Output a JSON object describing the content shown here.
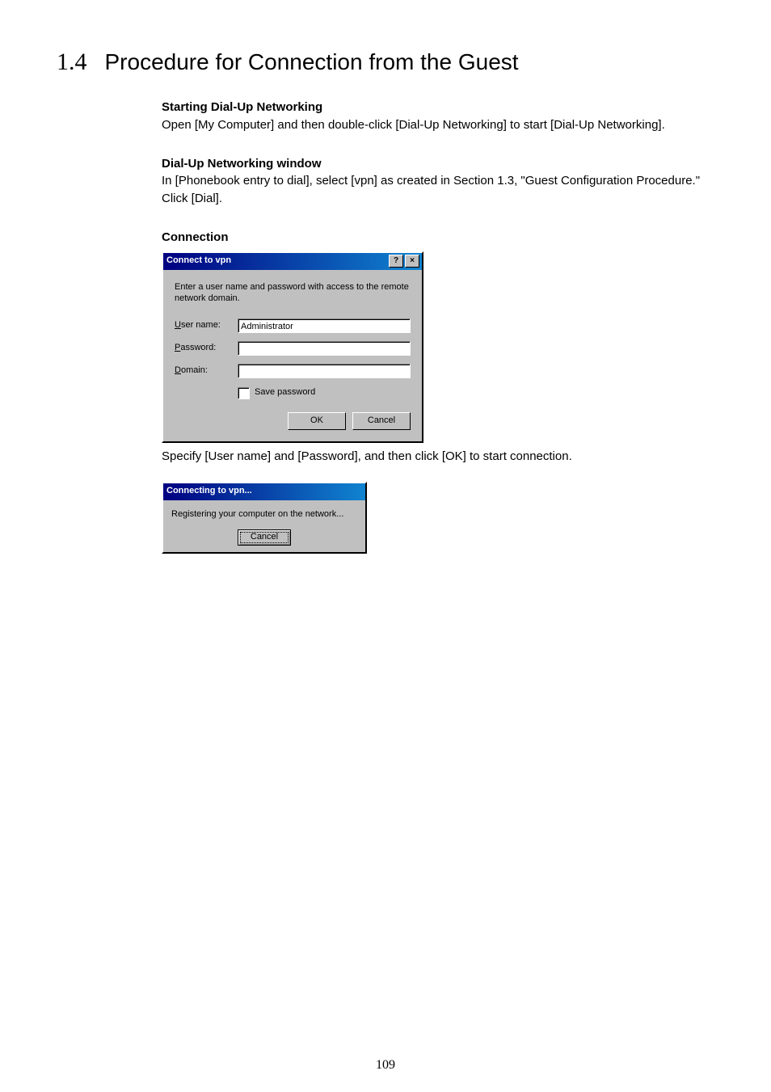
{
  "heading": {
    "number": "1.4",
    "title": "Procedure for Connection from the Guest"
  },
  "sections": {
    "start": {
      "subhead": "Starting Dial-Up Networking",
      "body": "Open [My Computer] and then double-click [Dial-Up Networking] to start [Dial-Up Networking]."
    },
    "dun_window": {
      "subhead": "Dial-Up Networking window",
      "body1": "In [Phonebook entry to dial], select [vpn] as created in Section 1.3, \"Guest Configuration Procedure.\"",
      "body2": "Click [Dial]."
    },
    "connection": {
      "subhead": "Connection"
    },
    "after_dialog": "Specify [User name] and [Password], and then click [OK] to start connection."
  },
  "dialog1": {
    "title": "Connect to vpn",
    "help_glyph": "?",
    "close_glyph": "×",
    "instruction": "Enter a user name and password with access to the remote network domain.",
    "fields": {
      "username_label_pre": "U",
      "username_label_rest": "ser name:",
      "username_value": "Administrator",
      "password_label_pre": "P",
      "password_label_rest": "assword:",
      "password_value": "",
      "domain_label_pre": "D",
      "domain_label_rest": "omain:",
      "domain_value": "",
      "savepw_pre": "S",
      "savepw_rest": "ave password"
    },
    "buttons": {
      "ok": "OK",
      "cancel": "Cancel"
    }
  },
  "dialog2": {
    "title": "Connecting to vpn...",
    "status": "Registering your computer on the network...",
    "cancel": "Cancel"
  },
  "page_number": "109"
}
